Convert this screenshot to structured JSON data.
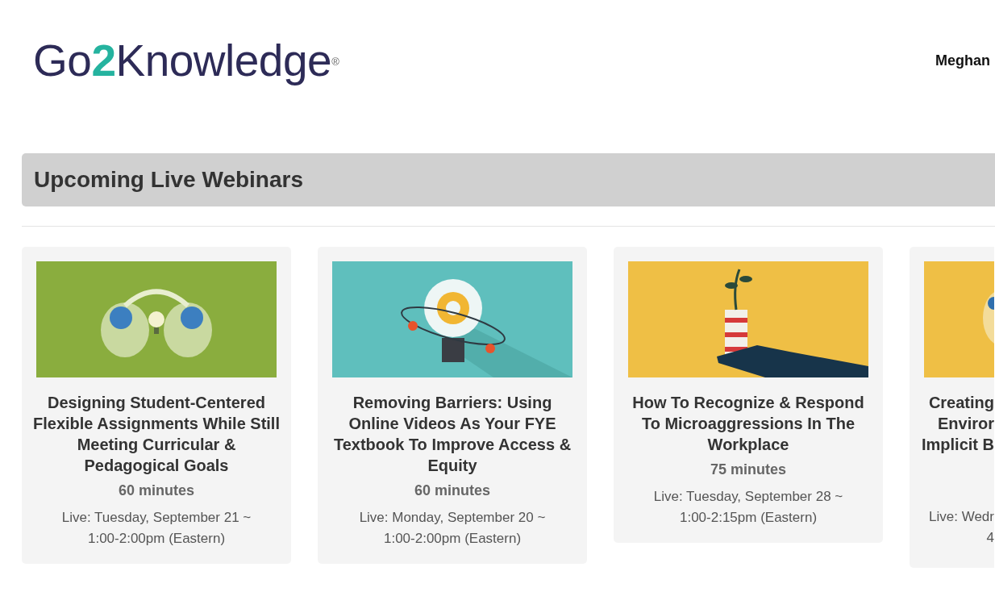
{
  "header": {
    "logo": {
      "before": "Go",
      "accent": "2",
      "after": "Knowledge",
      "mark": "®"
    },
    "user_name": "Meghan"
  },
  "section": {
    "title": "Upcoming Live Webinars"
  },
  "webinars": [
    {
      "kind": "full",
      "title": "Designing Student-Centered Flexible Assignments While Still Meeting Curricular & Pedagogical Goals",
      "duration": "60 minutes",
      "schedule": "Live: Tuesday, September 21 ~ 1:00-2:00pm (Eastern)"
    },
    {
      "kind": "full",
      "title": "Removing Barriers: Using Online Videos As Your FYE Textbook To Improve Access & Equity",
      "duration": "60 minutes",
      "schedule": "Live: Monday, September 20 ~ 1:00-2:00pm (Eastern)"
    },
    {
      "kind": "full",
      "title": "How To Recognize & Respond To Microaggressions In The Workplace",
      "duration": "75 minutes",
      "schedule": "Live: Tuesday, September 28 ~ 1:00-2:15pm (Eastern)"
    },
    {
      "kind": "cut",
      "title_lines": [
        "Creating",
        "Enviror",
        "Implicit B"
      ],
      "schedule_lines": [
        "Live: Wedr",
        "4"
      ]
    }
  ]
}
